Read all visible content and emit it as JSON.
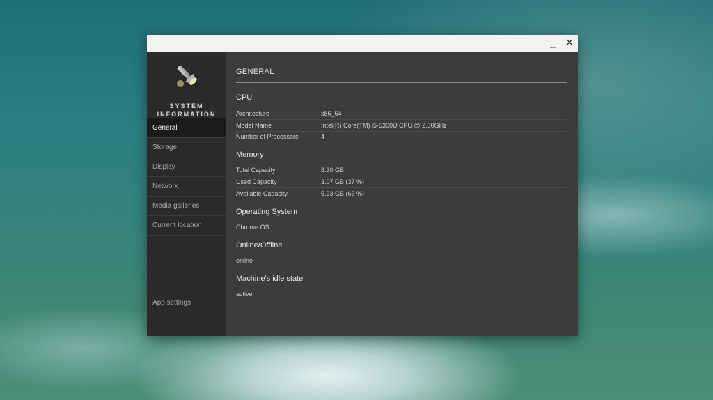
{
  "window": {
    "minimize_glyph": "_",
    "close_glyph": "✕"
  },
  "sidebar": {
    "logo_line1": "SYSTEM",
    "logo_line2": "INFORMATION",
    "logo_icon": "flashlight-icon",
    "items": [
      {
        "label": "General",
        "active": true
      },
      {
        "label": "Storage"
      },
      {
        "label": "Display"
      },
      {
        "label": "Network"
      },
      {
        "label": "Media galleries"
      },
      {
        "label": "Current location"
      }
    ],
    "settings_label": "App settings"
  },
  "main": {
    "title": "GENERAL",
    "cpu": {
      "heading": "CPU",
      "rows": [
        {
          "key": "Architecture",
          "value": "x86_64"
        },
        {
          "key": "Model Name",
          "value": "Intel(R) Core(TM) i5-5300U CPU @ 2.30GHz"
        },
        {
          "key": "Number of Processors",
          "value": "4"
        }
      ]
    },
    "memory": {
      "heading": "Memory",
      "rows": [
        {
          "key": "Total Capacity",
          "value": "8.30 GB"
        },
        {
          "key": "Used Capacity",
          "value": "3.07 GB (37 %)"
        },
        {
          "key": "Available Capacity",
          "value": "5.23 GB (63 %)"
        }
      ]
    },
    "os": {
      "heading": "Operating System",
      "value": "Chrome OS"
    },
    "online": {
      "heading": "Online/Offline",
      "value": "online"
    },
    "idle": {
      "heading": "Machine's idle state",
      "value": "active"
    }
  },
  "colors": {
    "sidebar_bg": "#2a2a2a",
    "content_bg": "#3c3c3c",
    "active_item_bg": "#1b1b1b",
    "titlebar_bg": "#f2f2f2"
  }
}
